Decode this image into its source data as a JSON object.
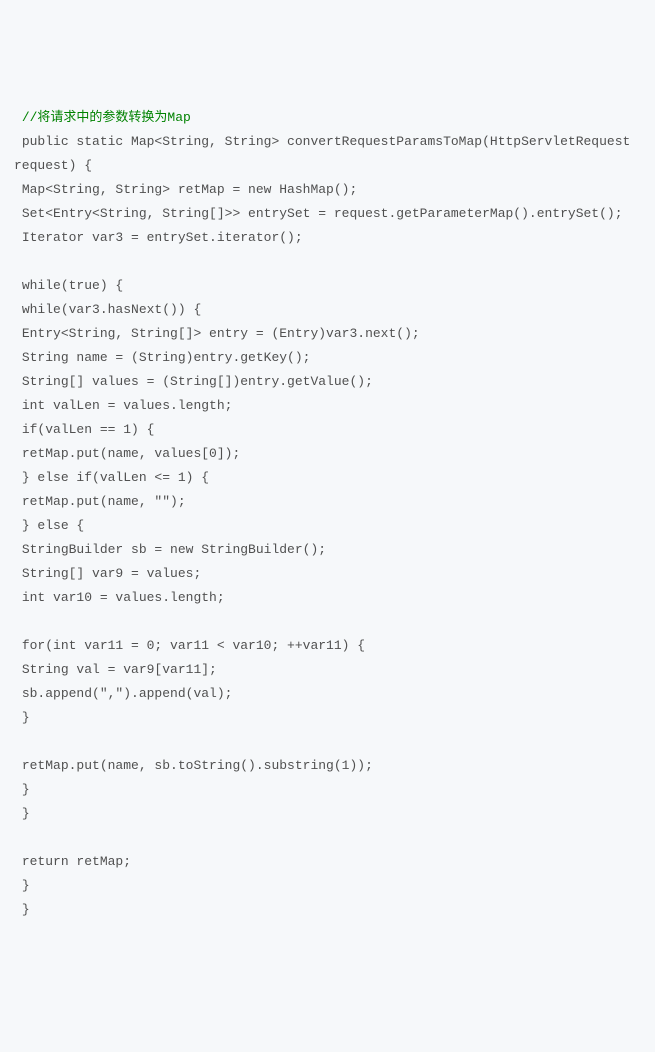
{
  "code": {
    "lines": [
      {
        "text": " //将请求中的参数转换为Map",
        "isComment": true
      },
      {
        "text": " public static Map<String, String> convertRequestParamsToMap(HttpServletRequest request) {",
        "isComment": false
      },
      {
        "text": " Map<String, String> retMap = new HashMap();",
        "isComment": false
      },
      {
        "text": " Set<Entry<String, String[]>> entrySet = request.getParameterMap().entrySet();",
        "isComment": false
      },
      {
        "text": " Iterator var3 = entrySet.iterator();",
        "isComment": false
      },
      {
        "text": "",
        "isComment": false
      },
      {
        "text": " while(true) {",
        "isComment": false
      },
      {
        "text": " while(var3.hasNext()) {",
        "isComment": false
      },
      {
        "text": " Entry<String, String[]> entry = (Entry)var3.next();",
        "isComment": false
      },
      {
        "text": " String name = (String)entry.getKey();",
        "isComment": false
      },
      {
        "text": " String[] values = (String[])entry.getValue();",
        "isComment": false
      },
      {
        "text": " int valLen = values.length;",
        "isComment": false
      },
      {
        "text": " if(valLen == 1) {",
        "isComment": false
      },
      {
        "text": " retMap.put(name, values[0]);",
        "isComment": false
      },
      {
        "text": " } else if(valLen <= 1) {",
        "isComment": false
      },
      {
        "text": " retMap.put(name, \"\");",
        "isComment": false
      },
      {
        "text": " } else {",
        "isComment": false
      },
      {
        "text": " StringBuilder sb = new StringBuilder();",
        "isComment": false
      },
      {
        "text": " String[] var9 = values;",
        "isComment": false
      },
      {
        "text": " int var10 = values.length;",
        "isComment": false
      },
      {
        "text": "",
        "isComment": false
      },
      {
        "text": " for(int var11 = 0; var11 < var10; ++var11) {",
        "isComment": false
      },
      {
        "text": " String val = var9[var11];",
        "isComment": false
      },
      {
        "text": " sb.append(\",\").append(val);",
        "isComment": false
      },
      {
        "text": " }",
        "isComment": false
      },
      {
        "text": "",
        "isComment": false
      },
      {
        "text": " retMap.put(name, sb.toString().substring(1));",
        "isComment": false
      },
      {
        "text": " }",
        "isComment": false
      },
      {
        "text": " }",
        "isComment": false
      },
      {
        "text": "",
        "isComment": false
      },
      {
        "text": " return retMap;",
        "isComment": false
      },
      {
        "text": " }",
        "isComment": false
      },
      {
        "text": " }",
        "isComment": false
      }
    ]
  }
}
